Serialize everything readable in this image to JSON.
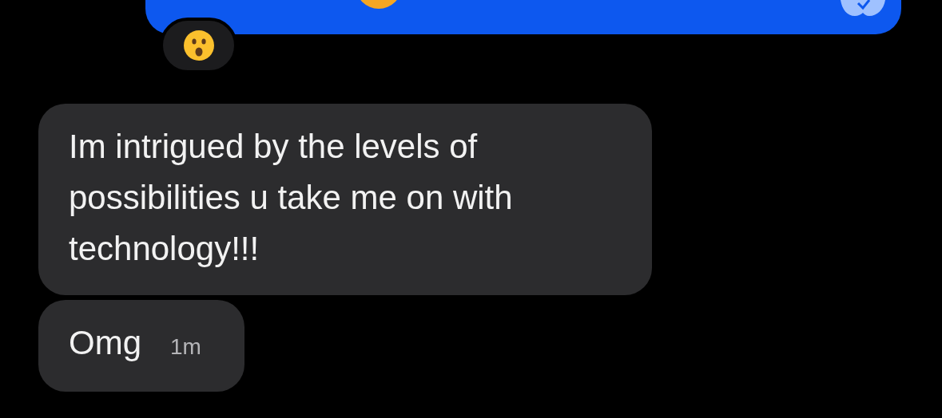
{
  "messages": [
    {
      "kind": "sent",
      "reacted": true
    },
    {
      "kind": "received",
      "text": "Im intrigued by the levels of possibilities u take me on with technology!!!"
    },
    {
      "kind": "received",
      "text": "Omg",
      "time": "1m"
    }
  ]
}
